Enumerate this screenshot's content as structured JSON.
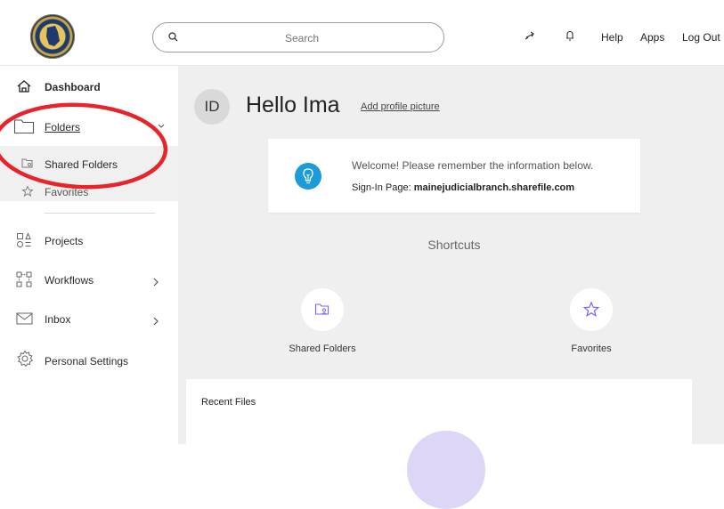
{
  "header": {
    "search_placeholder": "Search",
    "links": {
      "help": "Help",
      "apps": "Apps",
      "logout": "Log Out"
    },
    "icons": [
      "seal-logo",
      "search-icon",
      "transfer-icon",
      "bell-icon"
    ]
  },
  "sidebar": {
    "items": [
      {
        "label": "Dashboard",
        "icon": "home-icon"
      },
      {
        "label": "Folders",
        "icon": "folder-icon"
      },
      {
        "label": "Shared Folders",
        "icon": "shared-folder-icon"
      },
      {
        "label": "Favorites",
        "icon": "star-icon"
      },
      {
        "label": "Projects",
        "icon": "projects-icon"
      },
      {
        "label": "Workflows",
        "icon": "workflows-icon"
      },
      {
        "label": "Inbox",
        "icon": "inbox-icon"
      },
      {
        "label": "Personal Settings",
        "icon": "gear-icon"
      }
    ]
  },
  "main": {
    "avatar_initials": "ID",
    "greeting": "Hello Ima",
    "add_profile_picture": "Add profile picture",
    "welcome": {
      "message": "Welcome! Please remember the information below.",
      "signin_label": "Sign-In Page: ",
      "signin_value": "mainejudicialbranch.sharefile.com"
    },
    "shortcuts_title": "Shortcuts",
    "shortcuts": [
      {
        "label": "Shared Folders",
        "icon": "shared-folder-icon"
      },
      {
        "label": "Favorites",
        "icon": "star-icon"
      }
    ],
    "recent_files_title": "Recent Files"
  },
  "colors": {
    "accent_purple": "#7b61ff",
    "bulb_blue": "#1b9bd7",
    "annotation_red": "#e8232a",
    "main_bg": "#efefef"
  }
}
